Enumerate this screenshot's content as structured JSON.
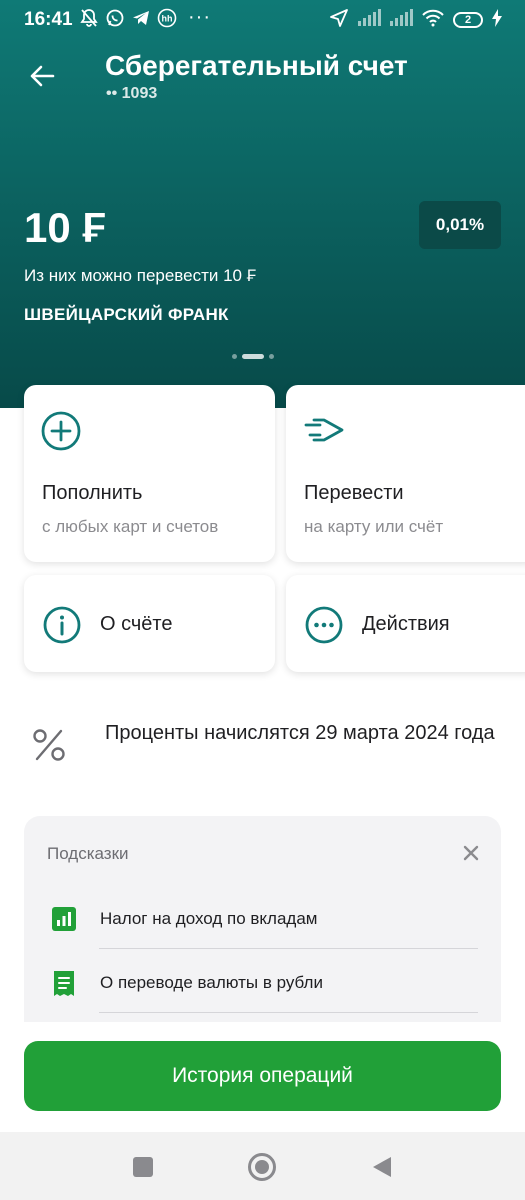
{
  "status_bar": {
    "time": "16:41",
    "left_icons": [
      "bell-off-icon",
      "whatsapp-icon",
      "telegram-icon",
      "hh-icon"
    ],
    "overflow": "···",
    "right_icons": [
      "location-icon",
      "signal-icon",
      "signal-icon",
      "wifi-icon"
    ],
    "battery": "2"
  },
  "header": {
    "title": "Сберегательный счет",
    "account": "•• 1093"
  },
  "account": {
    "balance": "10 ₣",
    "rate": "0,01%",
    "transferable": "Из них можно перевести 10 ₣",
    "currency": "ШВЕЙЦАРСКИЙ ФРАНК",
    "pager": {
      "pages": 4,
      "active": 2
    }
  },
  "actions": {
    "topup": {
      "label": "Пополнить",
      "sub": "с любых карт и счетов",
      "icon": "plus-circle-icon"
    },
    "transfer": {
      "label": "Перевести",
      "sub": "на карту или счёт",
      "icon": "arrow-right-icon"
    },
    "about": {
      "label": "О счёте",
      "icon": "info-icon"
    },
    "more": {
      "label": "Действия",
      "icon": "more-icon"
    }
  },
  "interest": {
    "text": "Проценты начислятся 29 марта 2024 года",
    "icon": "percent-icon"
  },
  "tips": {
    "title": "Подсказки",
    "items": [
      {
        "label": "Налог на доход по вкладам",
        "icon": "chart-icon"
      },
      {
        "label": "О переводе валюты в рубли",
        "icon": "receipt-icon"
      }
    ]
  },
  "history_button": "История операций",
  "nav": [
    "square-icon",
    "home-circle-icon",
    "back-triangle-icon"
  ],
  "colors": {
    "brand_green": "#21a038",
    "hero_teal": "#0b5f5d",
    "icon_teal": "#127a79"
  }
}
